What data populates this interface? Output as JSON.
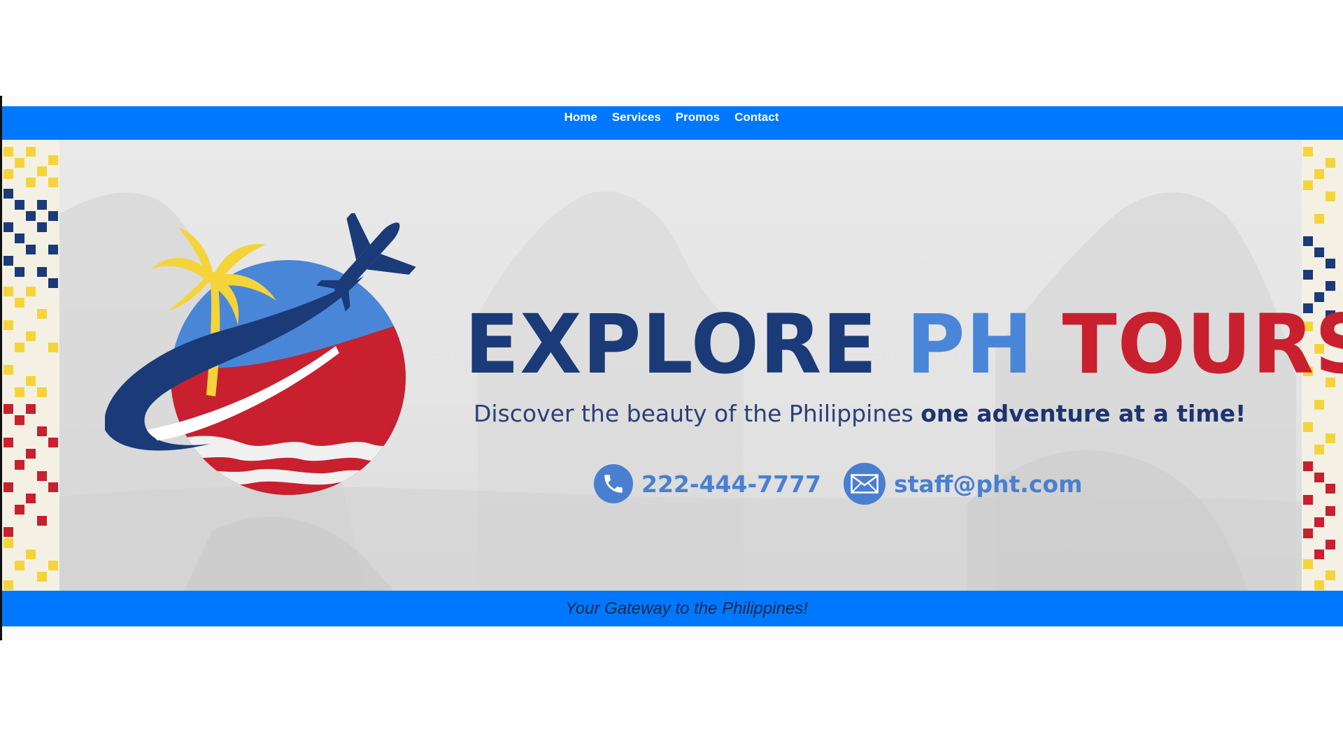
{
  "nav": {
    "items": [
      {
        "label": "Home"
      },
      {
        "label": "Services"
      },
      {
        "label": "Promos"
      },
      {
        "label": "Contact"
      }
    ]
  },
  "banner": {
    "title_part1": "EXPLORE",
    "title_part2": "PH",
    "title_part3": "TOURS",
    "subtitle_regular": "Discover the beauty of the Philippines",
    "subtitle_bold": "one adventure at a time!",
    "phone": "222-444-7777",
    "email": "staff@pht.com"
  },
  "footer": {
    "tagline": "Your Gateway to the Philippines!"
  },
  "colors": {
    "nav_blue": "#0077ff",
    "navy": "#1b3a78",
    "light_blue": "#4a86d8",
    "red": "#c8202f",
    "yellow": "#f5d43a"
  },
  "icons": [
    "phone-icon",
    "email-icon",
    "palm-tree-icon",
    "airplane-icon",
    "globe-logo"
  ]
}
